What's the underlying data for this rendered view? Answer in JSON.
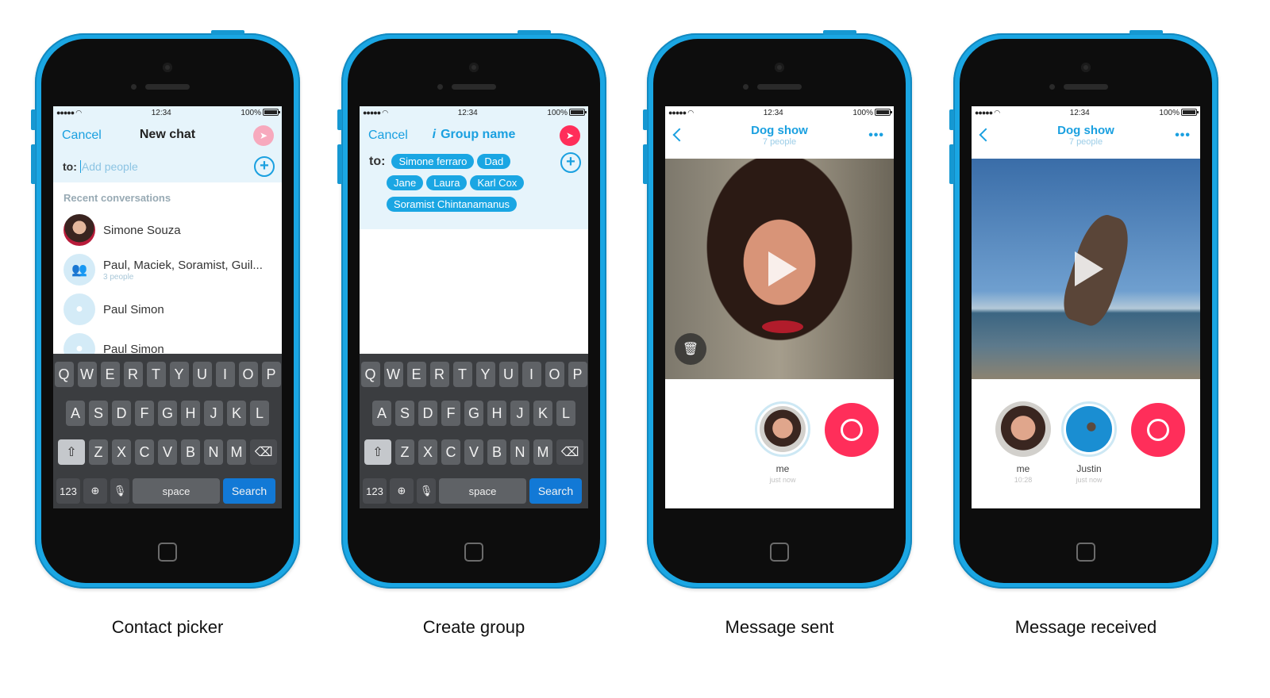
{
  "status": {
    "time": "12:34",
    "battery": "100%"
  },
  "keyboard": {
    "row1": [
      "Q",
      "W",
      "E",
      "R",
      "T",
      "Y",
      "U",
      "I",
      "O",
      "P"
    ],
    "row2": [
      "A",
      "S",
      "D",
      "F",
      "G",
      "H",
      "J",
      "K",
      "L"
    ],
    "row3": [
      "Z",
      "X",
      "C",
      "V",
      "B",
      "N",
      "M"
    ],
    "num": "123",
    "space": "space",
    "search": "Search"
  },
  "phones": [
    {
      "caption": "Contact picker",
      "nav": {
        "cancel": "Cancel",
        "title": "New chat"
      },
      "to_label": "to:",
      "to_placeholder": "Add people",
      "section": "Recent conversations",
      "contacts": [
        {
          "name": "Simone Souza",
          "sub": ""
        },
        {
          "name": "Paul, Maciek, Soramist, Guil...",
          "sub": "3 people"
        },
        {
          "name": "Paul Simon",
          "sub": ""
        },
        {
          "name": "Paul Simon",
          "sub": ""
        }
      ]
    },
    {
      "caption": "Create group",
      "nav": {
        "cancel": "Cancel",
        "title": "Group name"
      },
      "to_label": "to:",
      "chips": [
        [
          "Simone ferraro",
          "Dad"
        ],
        [
          "Jane",
          "Laura",
          "Karl Cox"
        ],
        [
          "Soramist Chintanamanus"
        ]
      ]
    },
    {
      "caption": "Message sent",
      "title": "Dog show",
      "subtitle": "7 people",
      "bubbles": [
        {
          "label": "me",
          "time": "just now"
        }
      ]
    },
    {
      "caption": "Message received",
      "title": "Dog show",
      "subtitle": "7 people",
      "bubbles": [
        {
          "label": "me",
          "time": "10:28"
        },
        {
          "label": "Justin",
          "time": "just now"
        }
      ]
    }
  ],
  "colors": {
    "accent": "#1aa0e0",
    "record": "#ff2e5a",
    "phone_body": "#1aa6e3",
    "search_key": "#1279d6"
  },
  "icons": [
    "send-icon",
    "plus-icon",
    "back-chevron-icon",
    "more-icon",
    "play-icon",
    "trash-icon",
    "record-icon",
    "shift-icon",
    "backspace-icon",
    "globe-icon",
    "mic-icon",
    "wifi-icon",
    "battery-icon"
  ]
}
